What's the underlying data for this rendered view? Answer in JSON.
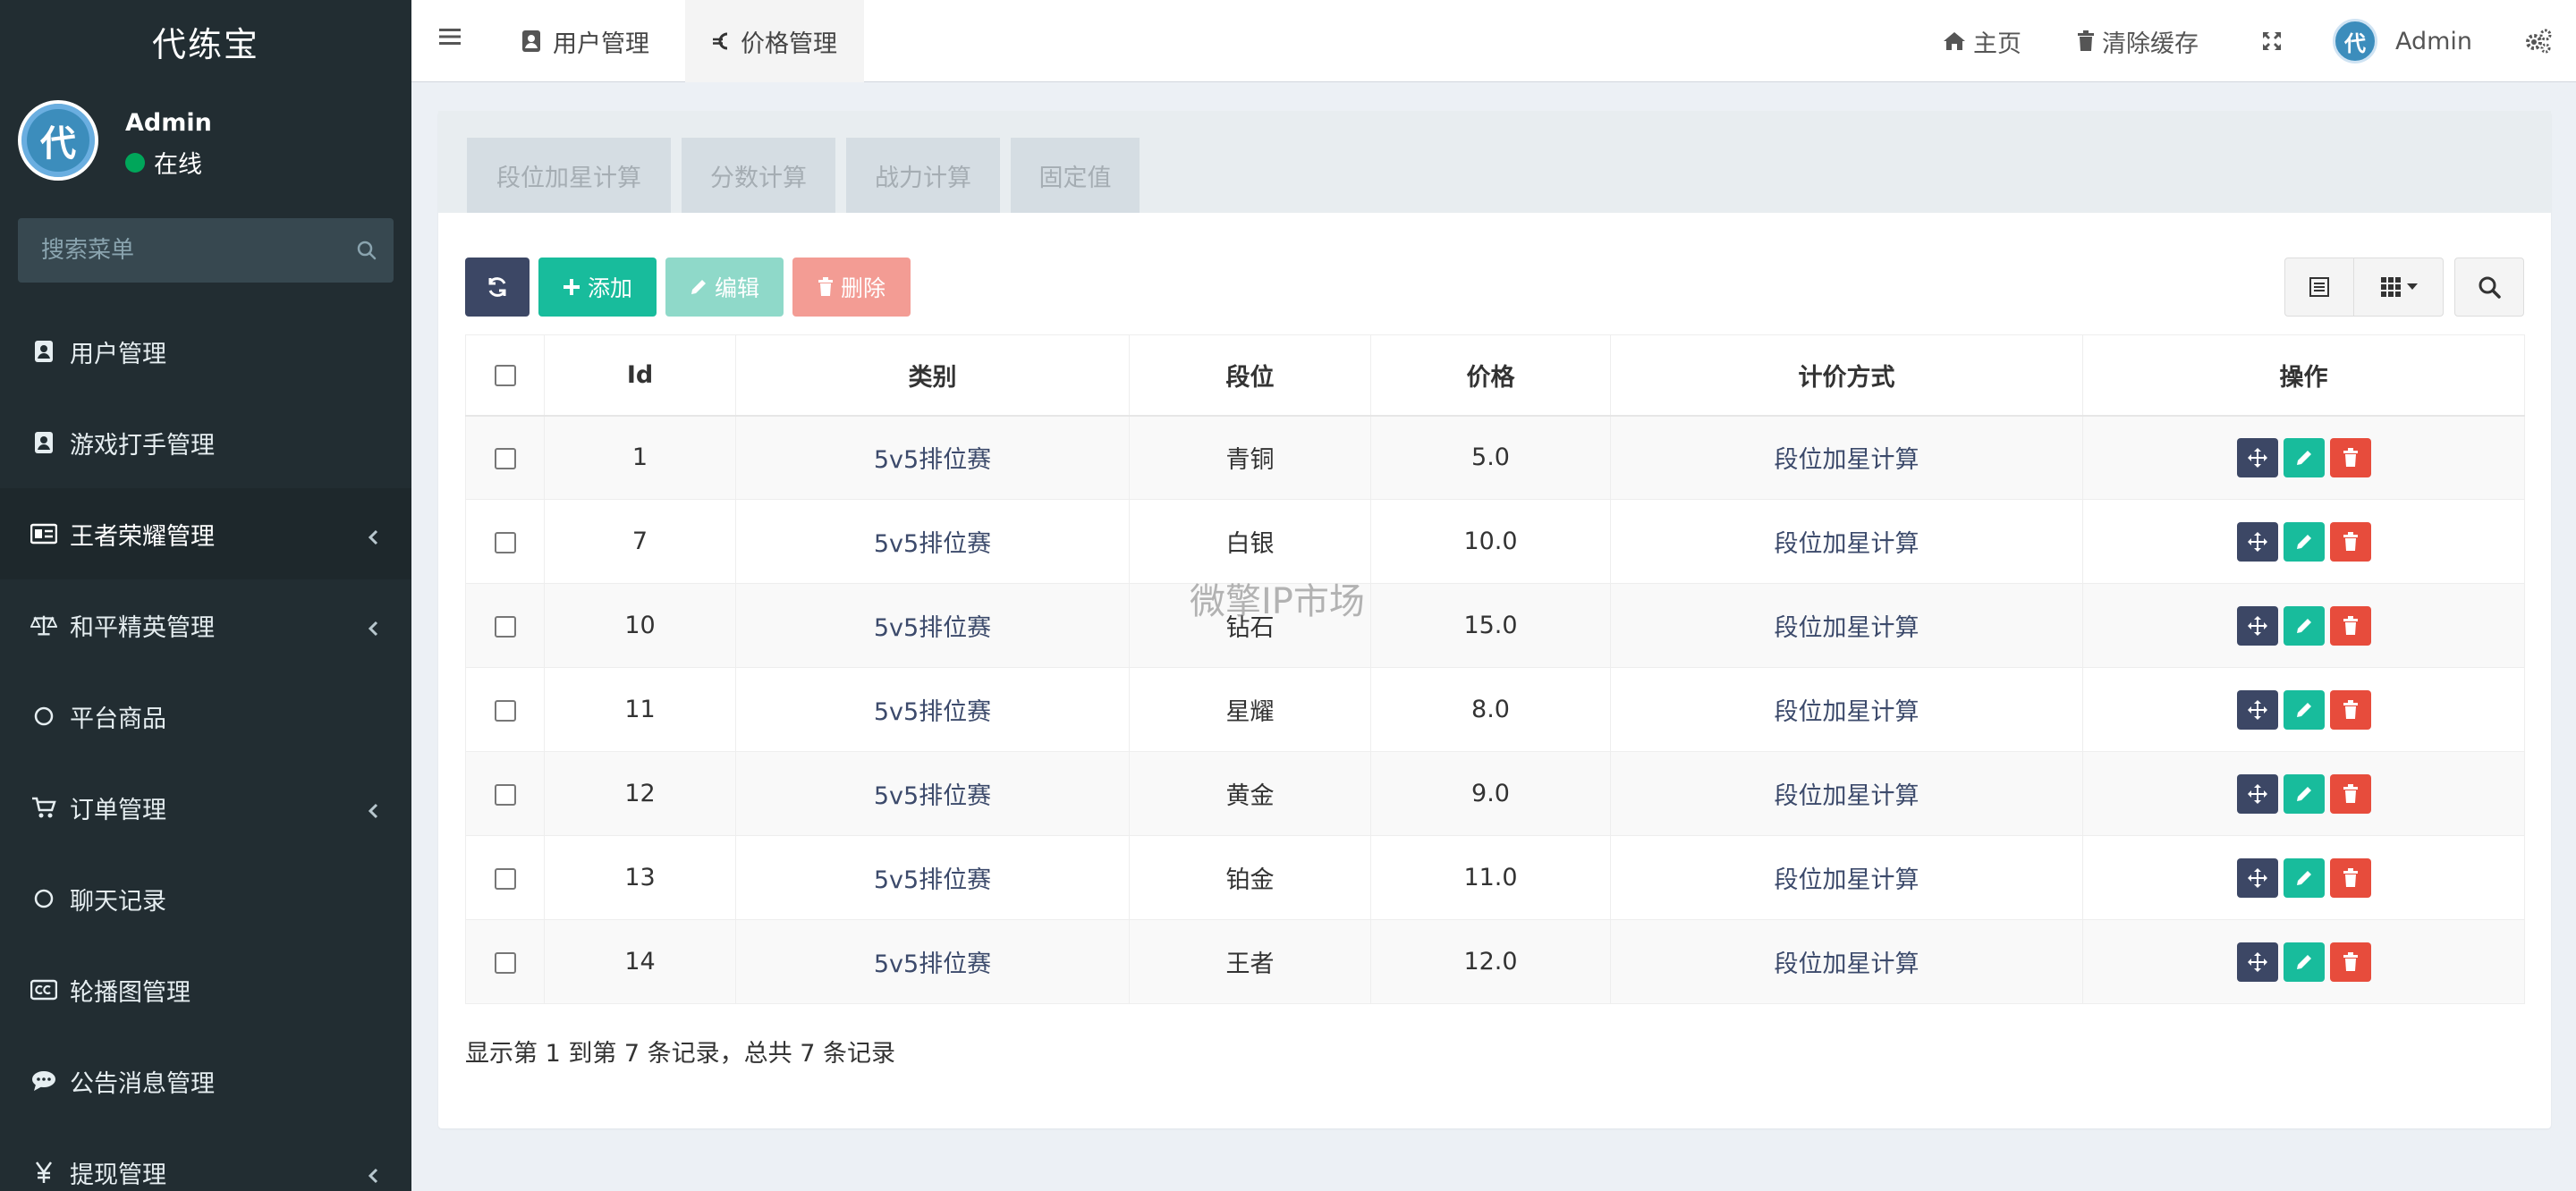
{
  "sidebar": {
    "logo": "代练宝",
    "user": {
      "avatar_char": "代",
      "name": "Admin",
      "status": "在线"
    },
    "search": {
      "placeholder": "搜索菜单"
    },
    "items": [
      {
        "label": "用户管理",
        "icon": "address-card-icon",
        "has_arrow": false,
        "active": false
      },
      {
        "label": "游戏打手管理",
        "icon": "address-card-icon",
        "has_arrow": false,
        "active": false
      },
      {
        "label": "王者荣耀管理",
        "icon": "id-card-icon",
        "has_arrow": true,
        "active": true
      },
      {
        "label": "和平精英管理",
        "icon": "balance-scale-icon",
        "has_arrow": true,
        "active": false
      },
      {
        "label": "平台商品",
        "icon": "circle-icon",
        "has_arrow": false,
        "active": false
      },
      {
        "label": "订单管理",
        "icon": "cart-icon",
        "has_arrow": true,
        "active": false
      },
      {
        "label": "聊天记录",
        "icon": "circle-icon",
        "has_arrow": false,
        "active": false
      },
      {
        "label": "轮播图管理",
        "icon": "cc-icon",
        "has_arrow": false,
        "active": false
      },
      {
        "label": "公告消息管理",
        "icon": "comment-icon",
        "has_arrow": false,
        "active": false
      },
      {
        "label": "提现管理",
        "icon": "yen-icon",
        "has_arrow": true,
        "active": false
      }
    ]
  },
  "topbar": {
    "tabs": [
      {
        "label": "用户管理",
        "icon": "address-card-icon"
      },
      {
        "label": "价格管理",
        "icon": "euro-icon"
      }
    ],
    "home": "主页",
    "clear_cache": "清除缓存",
    "user_name": "Admin",
    "avatar_char": "代"
  },
  "subtabs": [
    "段位加星计算",
    "分数计算",
    "战力计算",
    "固定值"
  ],
  "toolbar": {
    "add": "添加",
    "edit": "编辑",
    "delete": "删除"
  },
  "colors": {
    "refresh": "#3c4765",
    "add": "#18bc9c",
    "edit": "#8fd9c9",
    "delete": "#f39c94"
  },
  "table": {
    "columns": [
      "Id",
      "类别",
      "段位",
      "价格",
      "计价方式",
      "操作"
    ],
    "rows": [
      {
        "id": "1",
        "category": "5v5排位赛",
        "rank": "青铜",
        "price": "5.0",
        "method": "段位加星计算"
      },
      {
        "id": "7",
        "category": "5v5排位赛",
        "rank": "白银",
        "price": "10.0",
        "method": "段位加星计算"
      },
      {
        "id": "10",
        "category": "5v5排位赛",
        "rank": "钻石",
        "price": "15.0",
        "method": "段位加星计算"
      },
      {
        "id": "11",
        "category": "5v5排位赛",
        "rank": "星耀",
        "price": "8.0",
        "method": "段位加星计算"
      },
      {
        "id": "12",
        "category": "5v5排位赛",
        "rank": "黄金",
        "price": "9.0",
        "method": "段位加星计算"
      },
      {
        "id": "13",
        "category": "5v5排位赛",
        "rank": "铂金",
        "price": "11.0",
        "method": "段位加星计算"
      },
      {
        "id": "14",
        "category": "5v5排位赛",
        "rank": "王者",
        "price": "12.0",
        "method": "段位加星计算"
      }
    ]
  },
  "summary": "显示第 1 到第 7 条记录，总共 7 条记录",
  "watermark": "微擎IP市场"
}
